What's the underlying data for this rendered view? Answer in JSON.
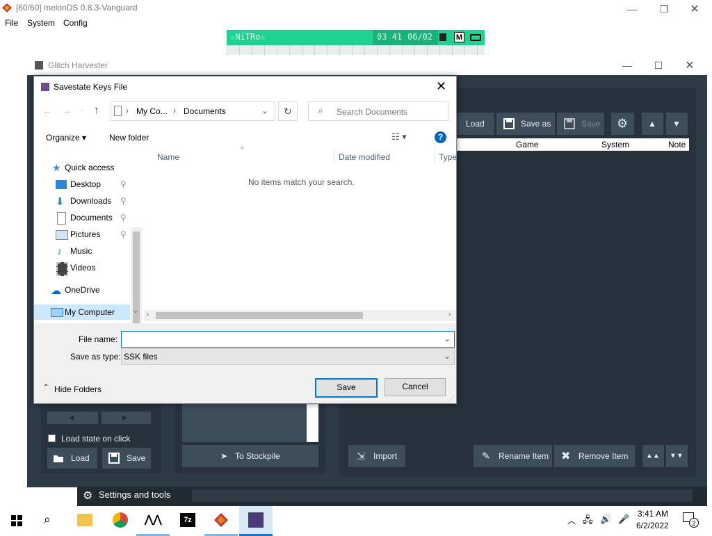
{
  "melon": {
    "title": "[60/60] melonDS 0.8.3-Vanguard",
    "menu": [
      "File",
      "System",
      "Config"
    ],
    "ds": {
      "nitro": "☆NiTRo☆",
      "time": "03 41",
      "date": "06/02"
    }
  },
  "harvester": {
    "title": "Glitch Harvester",
    "toolbar": {
      "load": "Load",
      "save_as": "Save as",
      "save": "Save"
    },
    "columns": {
      "game": "Game",
      "system": "System",
      "note": "Note"
    },
    "load_state_on_click": "Load state on click",
    "left_buttons": {
      "load": "Load",
      "save": "Save"
    },
    "to_stockpile": "To Stockpile",
    "import": "Import",
    "rename_item": "Rename Item",
    "remove_item": "Remove Item",
    "settings_tools": "Settings and tools"
  },
  "dialog": {
    "title": "Savestate Keys File",
    "breadcrumb": [
      "My Co...",
      "Documents"
    ],
    "search_placeholder": "Search Documents",
    "organize": "Organize",
    "new_folder": "New folder",
    "nav": {
      "quick_access": "Quick access",
      "desktop": "Desktop",
      "downloads": "Downloads",
      "documents": "Documents",
      "pictures": "Pictures",
      "music": "Music",
      "videos": "Videos",
      "onedrive": "OneDrive",
      "my_computer": "My Computer"
    },
    "columns": {
      "name": "Name",
      "date_modified": "Date modified",
      "type": "Type"
    },
    "empty_message": "No items match your search.",
    "file_name_label": "File name:",
    "file_name_value": "",
    "save_as_type_label": "Save as type:",
    "save_as_type_value": "SSK files",
    "hide_folders": "Hide Folders",
    "save": "Save",
    "cancel": "Cancel"
  },
  "taskbar": {
    "time": "3:41 AM",
    "date": "6/2/2022",
    "notifications": "2"
  },
  "colors": {
    "harvester_bg": "#2d3b47",
    "harvester_button": "#3e4d5a",
    "ds_green": "#1ed28f",
    "accent_blue": "#0078d7"
  }
}
